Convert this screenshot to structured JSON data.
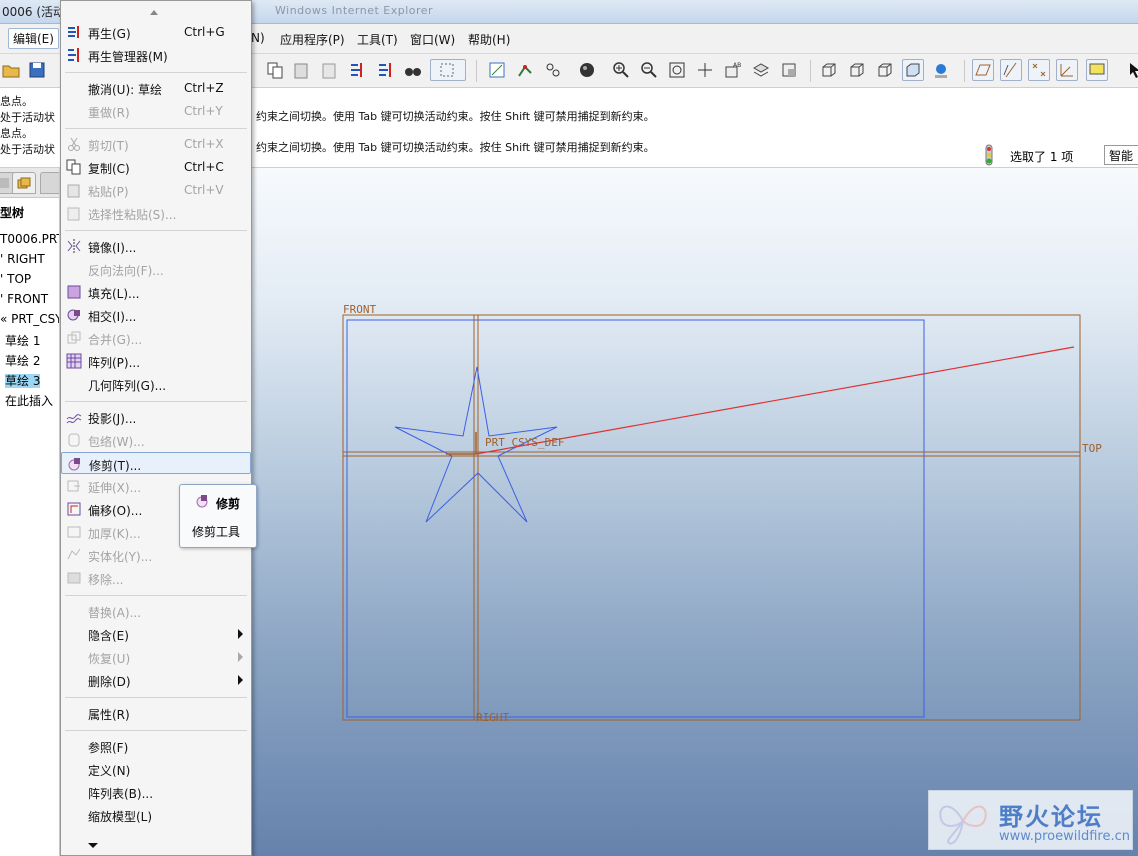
{
  "window": {
    "title": "0006 (活动",
    "browser_title_faded": "Windows Internet Explorer"
  },
  "menubar": {
    "items": [
      {
        "label": "编辑(E)",
        "active": true
      },
      {
        "label": "N)"
      },
      {
        "label": "应用程序(P)"
      },
      {
        "label": "工具(T)"
      },
      {
        "label": "窗口(W)"
      },
      {
        "label": "帮助(H)"
      }
    ]
  },
  "messages": {
    "line1_left": "息点。",
    "line2_left": "处于活动状",
    "line3_left": "息点。",
    "line4_left": "处于活动状",
    "line_right_1": "约束之间切换。使用 Tab 键可切换活动约束。按住 Shift 键可禁用捕捉到新约束。",
    "line_right_2": "约束之间切换。使用 Tab 键可切换活动约束。按住 Shift 键可禁用捕捉到新约束。"
  },
  "status": {
    "selected": "选取了 1 项",
    "filter": "智能"
  },
  "model_tree": {
    "header": "型树",
    "items": [
      {
        "label": "T0006.PRT"
      },
      {
        "label": "' RIGHT"
      },
      {
        "label": "' TOP"
      },
      {
        "label": "' FRONT"
      },
      {
        "label": "« PRT_CSYS"
      },
      {
        "label": "草绘 1"
      },
      {
        "label": "草绘 2"
      },
      {
        "label": "草绘 3",
        "selected": true
      },
      {
        "label": "在此插入"
      }
    ]
  },
  "context_menu": {
    "items": [
      {
        "label": "再生(G)",
        "shortcut": "Ctrl+G",
        "icon": "regenerate-icon"
      },
      {
        "label": "再生管理器(M)",
        "icon": "regen-manager-icon"
      },
      {
        "sep": true
      },
      {
        "label": "撤消(U): 草绘",
        "shortcut": "Ctrl+Z",
        "icon": "undo-icon"
      },
      {
        "label": "重做(R)",
        "shortcut": "Ctrl+Y",
        "disabled": true
      },
      {
        "sep": true
      },
      {
        "label": "剪切(T)",
        "shortcut": "Ctrl+X",
        "disabled": true,
        "icon": "scissors-icon"
      },
      {
        "label": "复制(C)",
        "shortcut": "Ctrl+C",
        "icon": "copy-icon"
      },
      {
        "label": "粘贴(P)",
        "shortcut": "Ctrl+V",
        "disabled": true,
        "icon": "paste-icon"
      },
      {
        "label": "选择性粘贴(S)...",
        "disabled": true,
        "icon": "paste-special-icon"
      },
      {
        "sep": true
      },
      {
        "label": "镜像(I)...",
        "icon": "mirror-icon"
      },
      {
        "label": "反向法向(F)...",
        "disabled": true
      },
      {
        "label": "填充(L)...",
        "icon": "fill-icon"
      },
      {
        "label": "相交(I)...",
        "icon": "intersect-icon"
      },
      {
        "label": "合并(G)...",
        "disabled": true,
        "icon": "merge-icon"
      },
      {
        "label": "阵列(P)...",
        "icon": "pattern-icon"
      },
      {
        "label": "几何阵列(G)..."
      },
      {
        "sep": true
      },
      {
        "label": "投影(J)...",
        "icon": "project-icon"
      },
      {
        "label": "包络(W)...",
        "disabled": true,
        "icon": "wrap-icon"
      },
      {
        "label": "修剪(T)...",
        "icon": "trim-icon",
        "highlighted": true
      },
      {
        "label": "延伸(X)...",
        "disabled": true,
        "icon": "extend-icon"
      },
      {
        "label": "偏移(O)...",
        "icon": "offset-icon"
      },
      {
        "label": "加厚(K)...",
        "disabled": true,
        "icon": "thicken-icon"
      },
      {
        "label": "实体化(Y)...",
        "disabled": true,
        "icon": "solidify-icon"
      },
      {
        "label": "移除...",
        "disabled": true,
        "icon": "remove-icon"
      },
      {
        "sep": true
      },
      {
        "label": "替换(A)...",
        "disabled": true
      },
      {
        "label": "隐含(E)",
        "submenu": true
      },
      {
        "label": "恢复(U)",
        "disabled": true,
        "submenu": true
      },
      {
        "label": "删除(D)",
        "submenu": true
      },
      {
        "sep": true
      },
      {
        "label": "属性(R)"
      },
      {
        "sep": true
      },
      {
        "label": "参照(F)"
      },
      {
        "label": "定义(N)"
      },
      {
        "label": "阵列表(B)..."
      },
      {
        "label": "缩放模型(L)"
      }
    ]
  },
  "tooltip": {
    "title": "修剪",
    "description": "修剪工具"
  },
  "canvas": {
    "labels": {
      "front": "FRONT",
      "top": "TOP",
      "right": "RIGHT",
      "csys": "PRT_CSYS_DEF"
    },
    "colors": {
      "datum": "#a0602a",
      "sketch": "#3c5fe6",
      "curve": "#e03030"
    }
  },
  "watermark": {
    "title": "野火论坛",
    "url": "www.proewildfire.cn"
  }
}
